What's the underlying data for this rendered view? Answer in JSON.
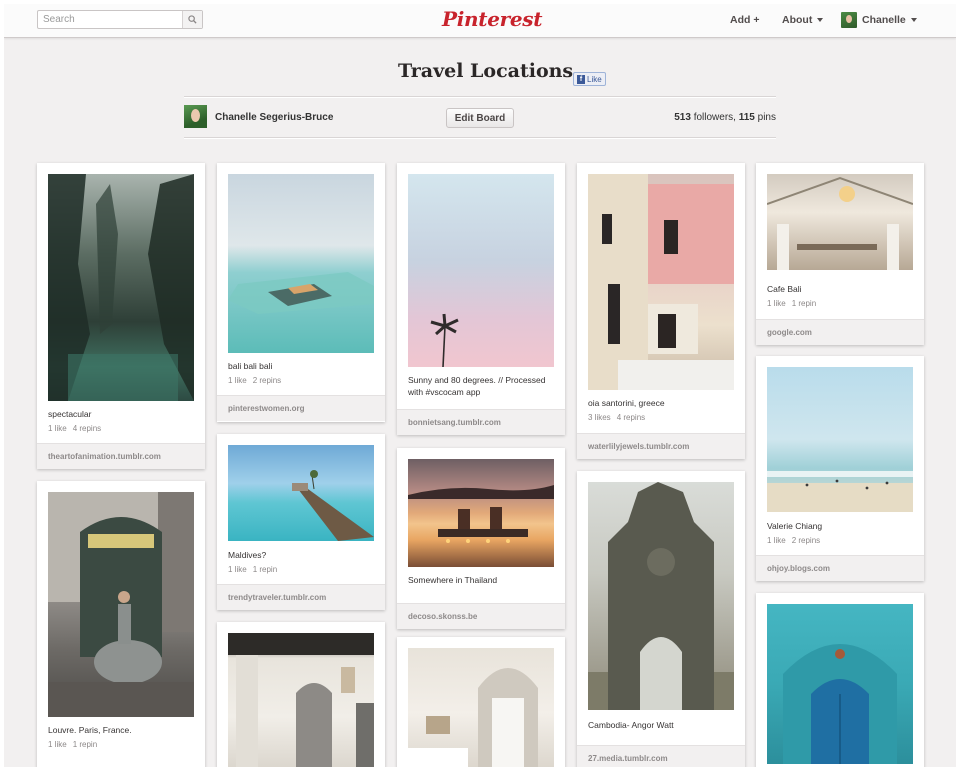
{
  "header": {
    "search_placeholder": "Search",
    "logo": "Pinterest",
    "add_label": "Add +",
    "about_label": "About",
    "user_label": "Chanelle"
  },
  "board": {
    "title": "Travel Locations",
    "fb_like": "Like",
    "owner": "Chanelle Segerius-Bruce",
    "edit_label": "Edit Board",
    "followers": "513",
    "followers_suffix": " followers, ",
    "pins": "115",
    "pins_suffix": " pins"
  },
  "pins": [
    {
      "desc": "spectacular",
      "likes": "1 like",
      "repins": "4 repins",
      "source": "theartofanimation.tumblr.com"
    },
    {
      "desc": "Louvre. Paris, France.",
      "likes": "1 like",
      "repins": "1 repin",
      "source": ""
    },
    {
      "desc": "bali bali bali",
      "likes": "1 like",
      "repins": "2 repins",
      "source": "pinterestwomen.org"
    },
    {
      "desc": "Maldives?",
      "likes": "1 like",
      "repins": "1 repin",
      "source": "trendytraveler.tumblr.com"
    },
    {
      "desc": "",
      "likes": "",
      "repins": "",
      "source": ""
    },
    {
      "desc": "Sunny and 80 degrees. // Processed with #vscocam app",
      "likes": "",
      "repins": "",
      "source": "bonnietsang.tumblr.com"
    },
    {
      "desc": "Somewhere in Thailand",
      "likes": "",
      "repins": "",
      "source": "decoso.skonss.be"
    },
    {
      "desc": "",
      "likes": "",
      "repins": "",
      "source": ""
    },
    {
      "desc": "oia santorini, greece",
      "likes": "3 likes",
      "repins": "4 repins",
      "source": "waterlilyjewels.tumblr.com"
    },
    {
      "desc": "Cambodia- Angor Watt",
      "likes": "",
      "repins": "",
      "source": "27.media.tumblr.com"
    },
    {
      "desc": "Cafe Bali",
      "likes": "1 like",
      "repins": "1 repin",
      "source": "google.com"
    },
    {
      "desc": "Valerie Chiang",
      "likes": "1 like",
      "repins": "2 repins",
      "source": "ohjoy.blogs.com"
    },
    {
      "desc": "",
      "likes": "",
      "repins": "",
      "source": ""
    }
  ]
}
